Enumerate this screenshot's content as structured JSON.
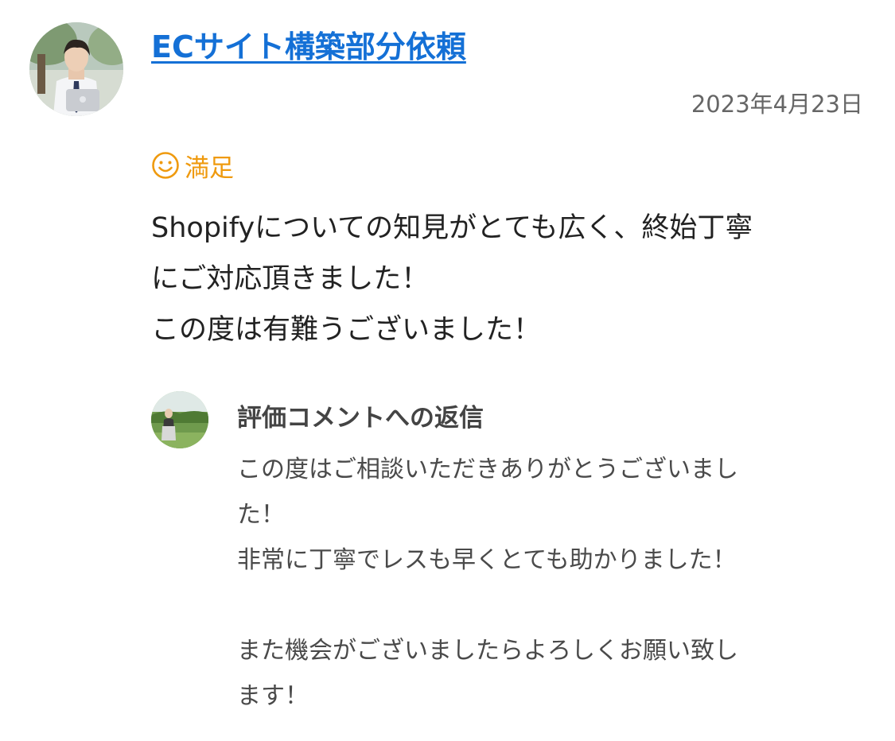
{
  "review": {
    "title": "ECサイト構築部分依頼",
    "date": "2023年4月23日",
    "rating_label": "満足",
    "rating_icon": "smiley-icon",
    "text_lines": [
      "Shopifyについての知見がとても広く、終始丁寧",
      "にご対応頂きました！",
      "この度は有難うございました！"
    ]
  },
  "reply": {
    "heading": "評価コメントへの返信",
    "body_lines": [
      "この度はご相談いただきありがとうございまし",
      "た！",
      "非常に丁寧でレスも早くとても助かりました！",
      "",
      "また機会がございましたらよろしくお願い致し",
      "ます！"
    ]
  },
  "colors": {
    "link": "#1470d6",
    "rating": "#ef9a0e",
    "text": "#222222",
    "muted": "#666666"
  }
}
